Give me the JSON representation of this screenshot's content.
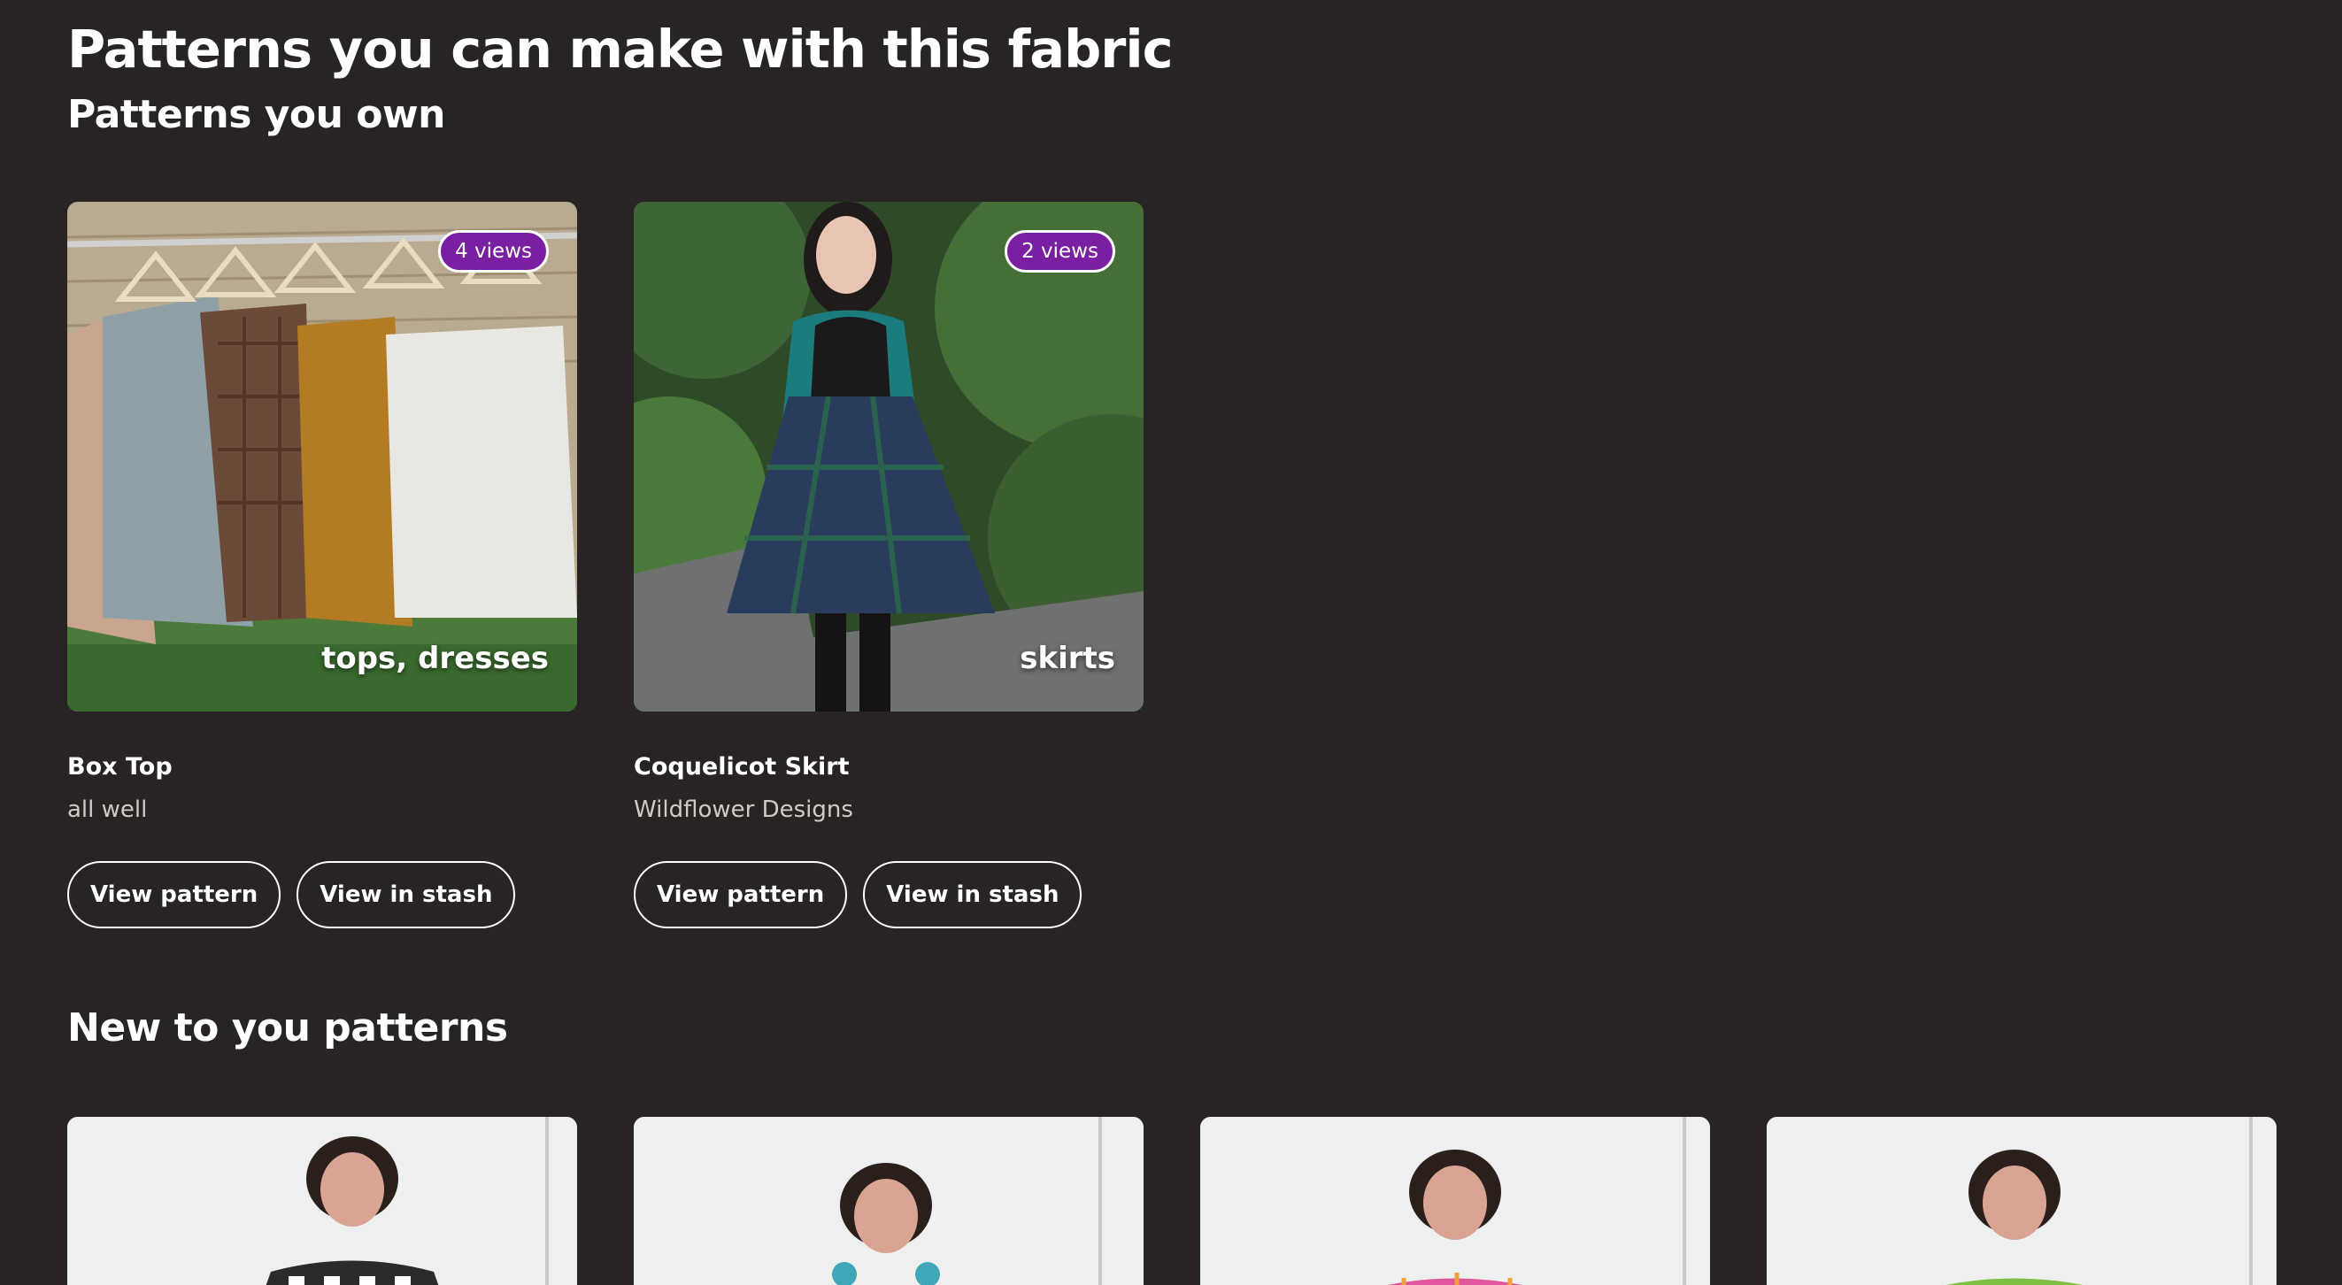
{
  "page": {
    "title": "Patterns you can make with this fabric",
    "owned_heading": "Patterns you own",
    "new_heading": "New to you patterns"
  },
  "owned_patterns": [
    {
      "name": "Box Top",
      "designer": "all well",
      "views": "4 views",
      "categories": "tops, dresses",
      "image_icon": "hanging-tops-photo",
      "actions": {
        "view_pattern": "View pattern",
        "view_stash": "View in stash"
      }
    },
    {
      "name": "Coquelicot Skirt",
      "designer": "Wildflower Designs",
      "views": "2 views",
      "categories": "skirts",
      "image_icon": "skirt-model-photo",
      "actions": {
        "view_pattern": "View pattern",
        "view_stash": "View in stash"
      }
    }
  ],
  "new_patterns": [
    {
      "image_icon": "model-gingham-top-photo",
      "garment_color": "#2b2b2b"
    },
    {
      "image_icon": "model-striped-top-photo",
      "garment_color": "#3fa7b8"
    },
    {
      "image_icon": "model-pink-check-top-photo",
      "garment_color": "#e0559b"
    },
    {
      "image_icon": "model-green-print-top-photo",
      "garment_color": "#7bc043"
    }
  ],
  "colors": {
    "background": "#272423",
    "badge": "#7a1fa2",
    "text": "#ffffff",
    "muted_text": "#cfcbc7"
  }
}
